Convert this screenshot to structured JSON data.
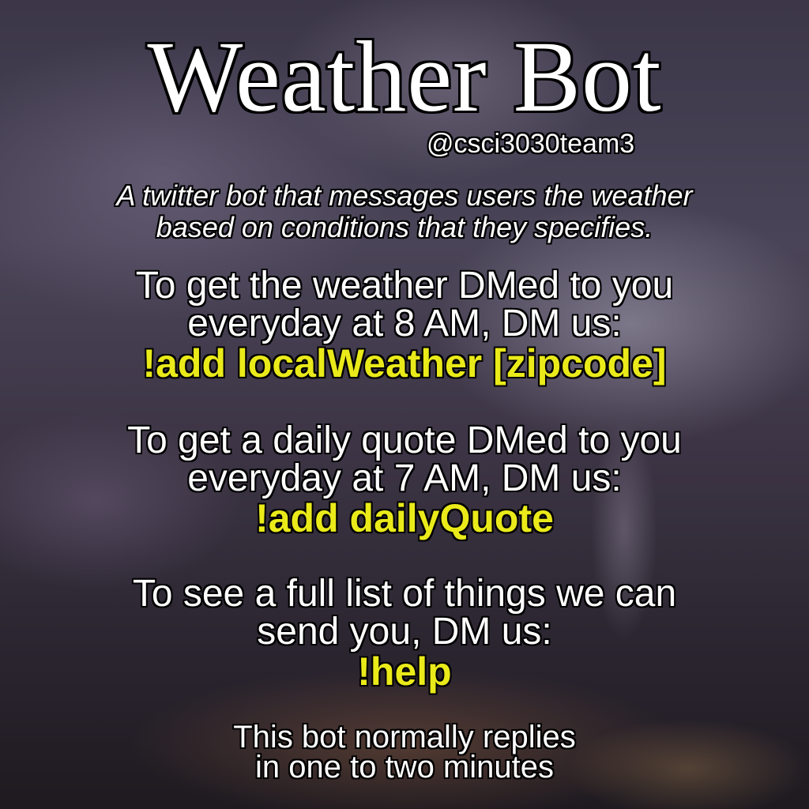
{
  "title": "Weather Bot",
  "handle": "@csci3030team3",
  "description": {
    "line1": "A twitter bot that messages users the weather",
    "line2": "based on conditions that they specifies."
  },
  "instructions": [
    {
      "line1": "To get the weather DMed to you",
      "line2": "everyday at 8 AM, DM us:",
      "command": "!add localWeather [zipcode]"
    },
    {
      "line1": "To get a daily quote DMed to you",
      "line2": "everyday at 7 AM, DM us:",
      "command": "!add dailyQuote"
    },
    {
      "line1": "To see a full list of things we can",
      "line2": "send you, DM us:",
      "command": "!help"
    }
  ],
  "footer": {
    "line1": "This bot normally replies",
    "line2": "in one to two minutes"
  },
  "colors": {
    "text": "#ffffff",
    "command": "#eaea1a",
    "outline": "#000000"
  }
}
